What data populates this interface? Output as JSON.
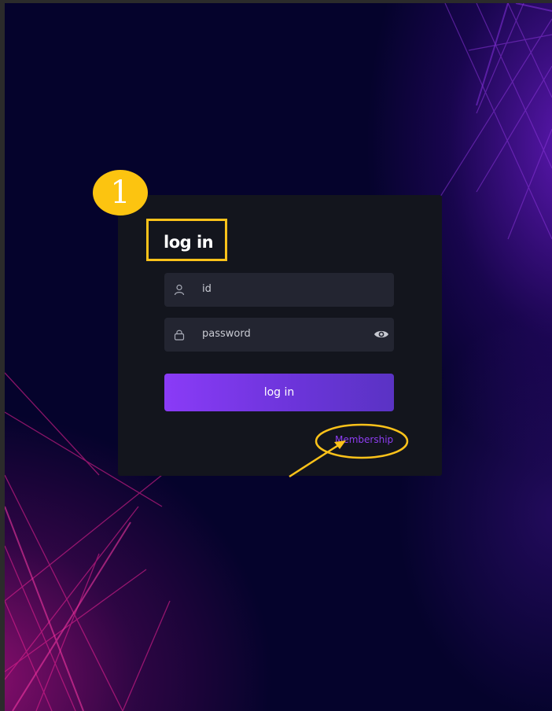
{
  "login": {
    "title": "log in",
    "id_placeholder": "id",
    "password_placeholder": "password",
    "submit_label": "log in",
    "membership_link": "Membership"
  },
  "annotation": {
    "step_number": "1",
    "highlight_color": "#fbc21a"
  },
  "colors": {
    "background": "#05032c",
    "card": "#13151d",
    "field": "#232531",
    "button_start": "#8a3bf7",
    "button_end": "#5a33c4",
    "link": "#8d3df0"
  },
  "icons": {
    "id_field": "user-icon",
    "password_field": "lock-icon",
    "password_toggle": "eye-icon"
  }
}
